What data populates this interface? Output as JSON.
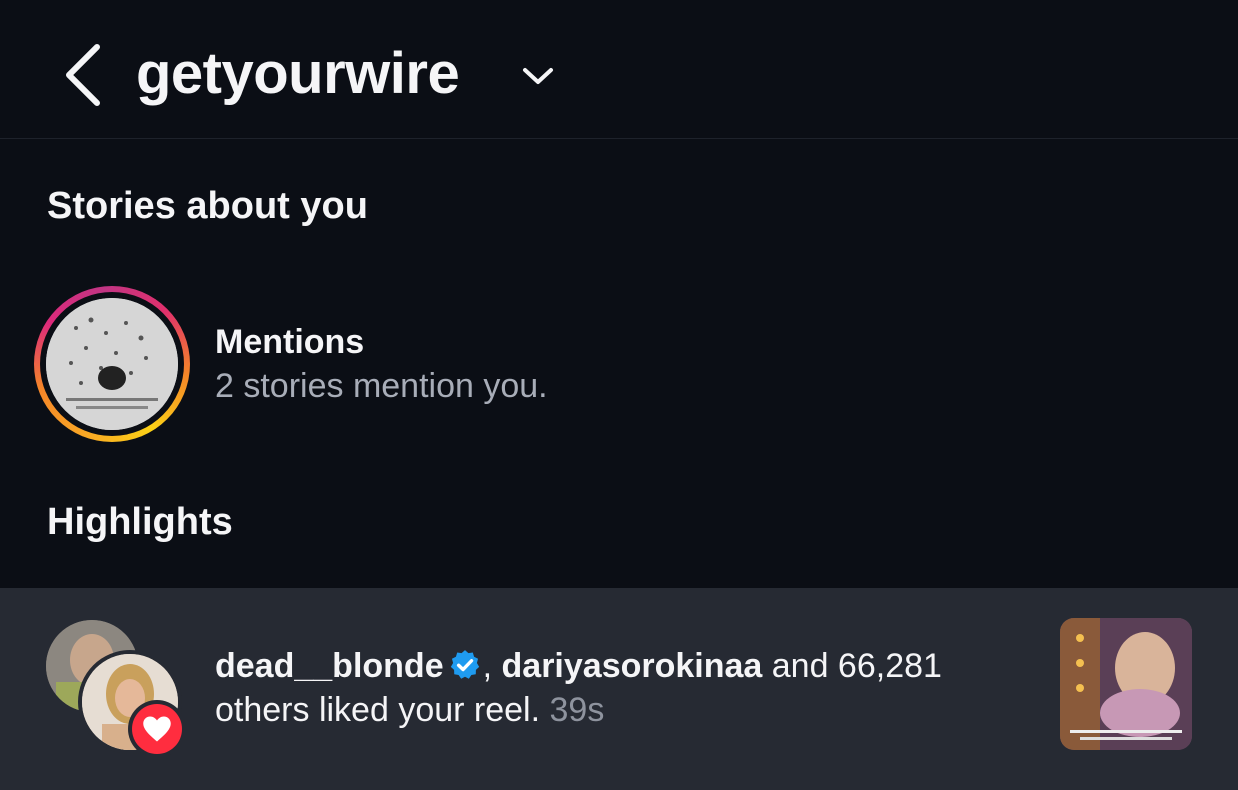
{
  "header": {
    "username": "getyourwire",
    "back_icon": "chevron-left-icon",
    "dropdown_icon": "chevron-down-icon"
  },
  "stories_about_you": {
    "title": "Stories about you",
    "mentions": {
      "label": "Mentions",
      "subtitle": "2 stories mention you."
    }
  },
  "highlights": {
    "title": "Highlights",
    "notification": {
      "user1": "dead__blonde",
      "separator": ",",
      "user2": "dariyasorokinaa",
      "rest_line": " and 66,281 others liked your reel.",
      "time": "39s",
      "badge_icon": "heart-icon",
      "verified_icon": "verified-badge-icon"
    }
  },
  "colors": {
    "background": "#0b0e15",
    "notification_bg": "#262a33",
    "heart_red": "#ff2d3f",
    "verified_blue": "#1f9bf0"
  }
}
